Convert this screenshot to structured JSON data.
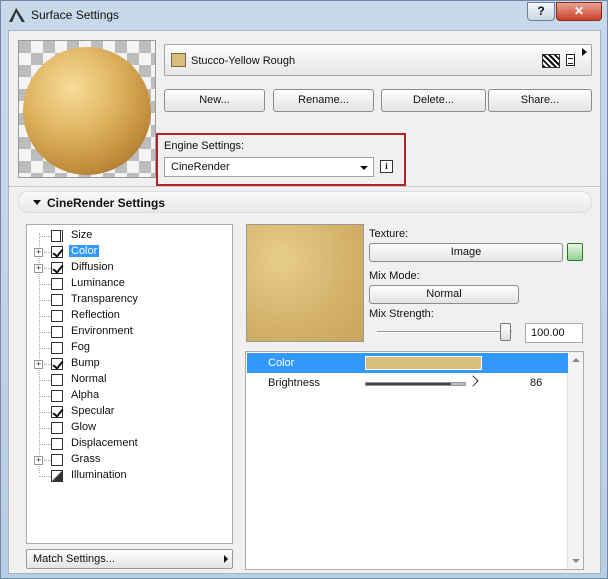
{
  "window": {
    "title": "Surface Settings",
    "help_label": "?",
    "close_label": "✕"
  },
  "material": {
    "name": "Stucco-Yellow Rough",
    "swatch_color": "#d8bd7c"
  },
  "buttons": {
    "new": "New...",
    "rename": "Rename...",
    "delete": "Delete...",
    "share": "Share..."
  },
  "engine": {
    "label": "Engine Settings:",
    "value": "CineRender",
    "info_label": "i"
  },
  "section": {
    "title": "CineRender Settings"
  },
  "channels": [
    {
      "label": "Size",
      "checked": false,
      "expandable": false,
      "icon": "size-icon"
    },
    {
      "label": "Color",
      "checked": true,
      "expandable": true,
      "selected": true
    },
    {
      "label": "Diffusion",
      "checked": true,
      "expandable": true
    },
    {
      "label": "Luminance",
      "checked": false,
      "expandable": false
    },
    {
      "label": "Transparency",
      "checked": false,
      "expandable": false
    },
    {
      "label": "Reflection",
      "checked": false,
      "expandable": false
    },
    {
      "label": "Environment",
      "checked": false,
      "expandable": false
    },
    {
      "label": "Fog",
      "checked": false,
      "expandable": false
    },
    {
      "label": "Bump",
      "checked": true,
      "expandable": true
    },
    {
      "label": "Normal",
      "checked": false,
      "expandable": false
    },
    {
      "label": "Alpha",
      "checked": false,
      "expandable": false
    },
    {
      "label": "Specular",
      "checked": true,
      "expandable": false
    },
    {
      "label": "Glow",
      "checked": false,
      "expandable": false
    },
    {
      "label": "Displacement",
      "checked": false,
      "expandable": false
    },
    {
      "label": "Grass",
      "checked": false,
      "expandable": true
    },
    {
      "label": "Illumination",
      "checked": false,
      "expandable": false,
      "icon": "illumination-icon"
    }
  ],
  "match_settings": {
    "label": "Match Settings..."
  },
  "texture": {
    "label": "Texture:",
    "image_button": "Image",
    "mix_mode_label": "Mix Mode:",
    "mix_mode_value": "Normal",
    "mix_strength_label": "Mix Strength:",
    "mix_strength_value": "100.00",
    "mix_strength_fraction": 1.0
  },
  "properties": [
    {
      "label": "Color",
      "type": "color",
      "color": "#d8bd7c",
      "selected": true
    },
    {
      "label": "Brightness",
      "type": "slider",
      "value": "86",
      "fraction": 0.86
    }
  ]
}
